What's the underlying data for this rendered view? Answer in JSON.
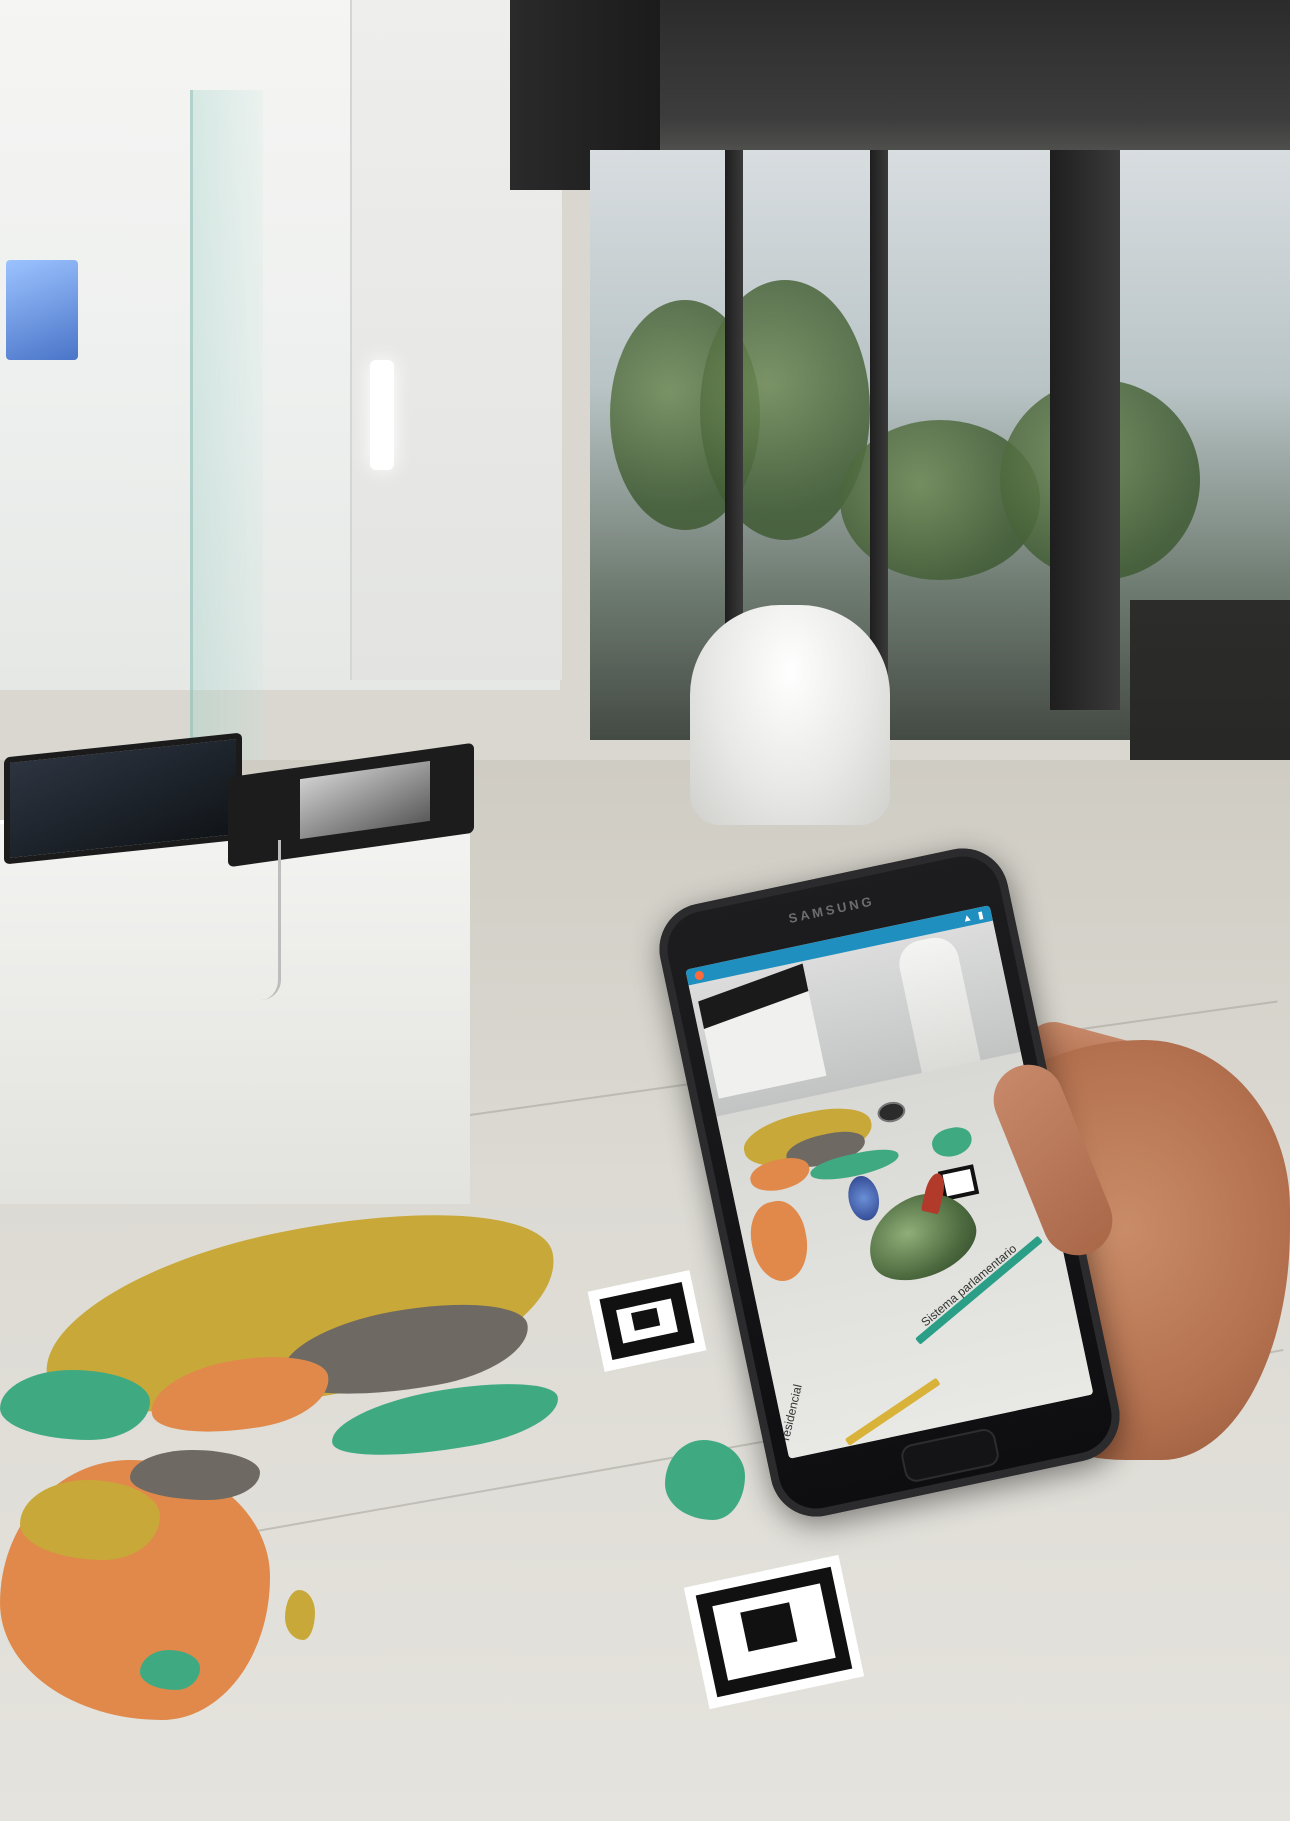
{
  "scene": {
    "phone_brand": "SAMSUNG",
    "ar_labels": {
      "label_center": "Sistema parlamentario",
      "label_left": "residencial"
    },
    "colors": {
      "map_yellow": "#c8a838",
      "map_orange": "#e0894a",
      "map_green": "#3faa82",
      "map_gray": "#6e6a63",
      "status_bar": "#1f8fbf",
      "label_bar_green": "#2a9e86",
      "label_bar_yellow": "#d9b23a"
    }
  }
}
